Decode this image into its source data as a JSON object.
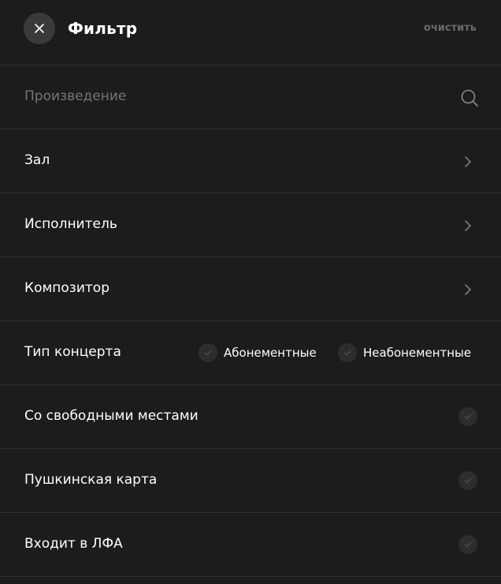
{
  "header": {
    "title": "Фильтр",
    "clear_label": "очистить"
  },
  "search": {
    "placeholder": "Произведение"
  },
  "filters": {
    "hall": "Зал",
    "performer": "Исполнитель",
    "composer": "Композитор",
    "concert_type": {
      "label": "Тип концерта",
      "options": [
        "Абонементные",
        "Неабонементные"
      ]
    },
    "free_seats": "Со свободными местами",
    "pushkin_card": "Пушкинская карта",
    "lfa": "Входит в ЛФА"
  },
  "colors": {
    "background": "#1c1c1c",
    "divider": "#2f2f2f",
    "close_button_bg": "#3a3a3a",
    "muted_text": "#6a6a6a",
    "check_bg": "#2d2d2d"
  },
  "icons": {
    "close": "close-icon",
    "search": "search-icon",
    "chevron": "chevron-right-icon",
    "check": "checkmark-icon"
  }
}
